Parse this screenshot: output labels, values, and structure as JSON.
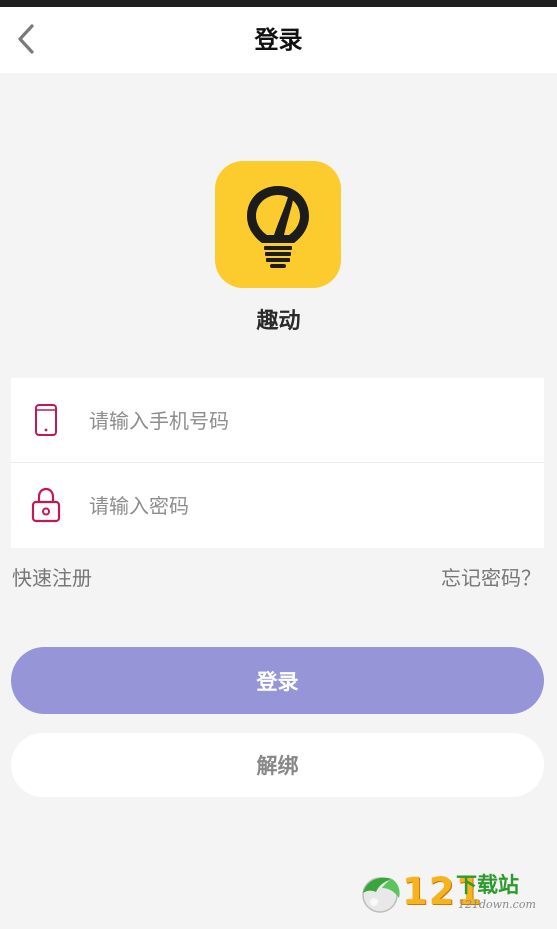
{
  "nav": {
    "title": "登录",
    "back_icon": "chevron-left-icon"
  },
  "app": {
    "name": "趣动",
    "logo_icon": "lightbulb-icon",
    "logo_color": "#fccb2d"
  },
  "form": {
    "phone": {
      "icon": "phone-icon",
      "placeholder": "请输入手机号码",
      "value": ""
    },
    "password": {
      "icon": "lock-icon",
      "placeholder": "请输入密码",
      "value": ""
    }
  },
  "links": {
    "register": "快速注册",
    "forgot_password": "忘记密码？"
  },
  "buttons": {
    "login": "登录",
    "unbind": "解绑"
  },
  "watermark": {
    "digits": "121",
    "text": "下载站",
    "domain": "121down.com"
  },
  "colors": {
    "accent": "#9595d8",
    "icon_accent": "#c2185b",
    "background": "#f4f4f4"
  }
}
